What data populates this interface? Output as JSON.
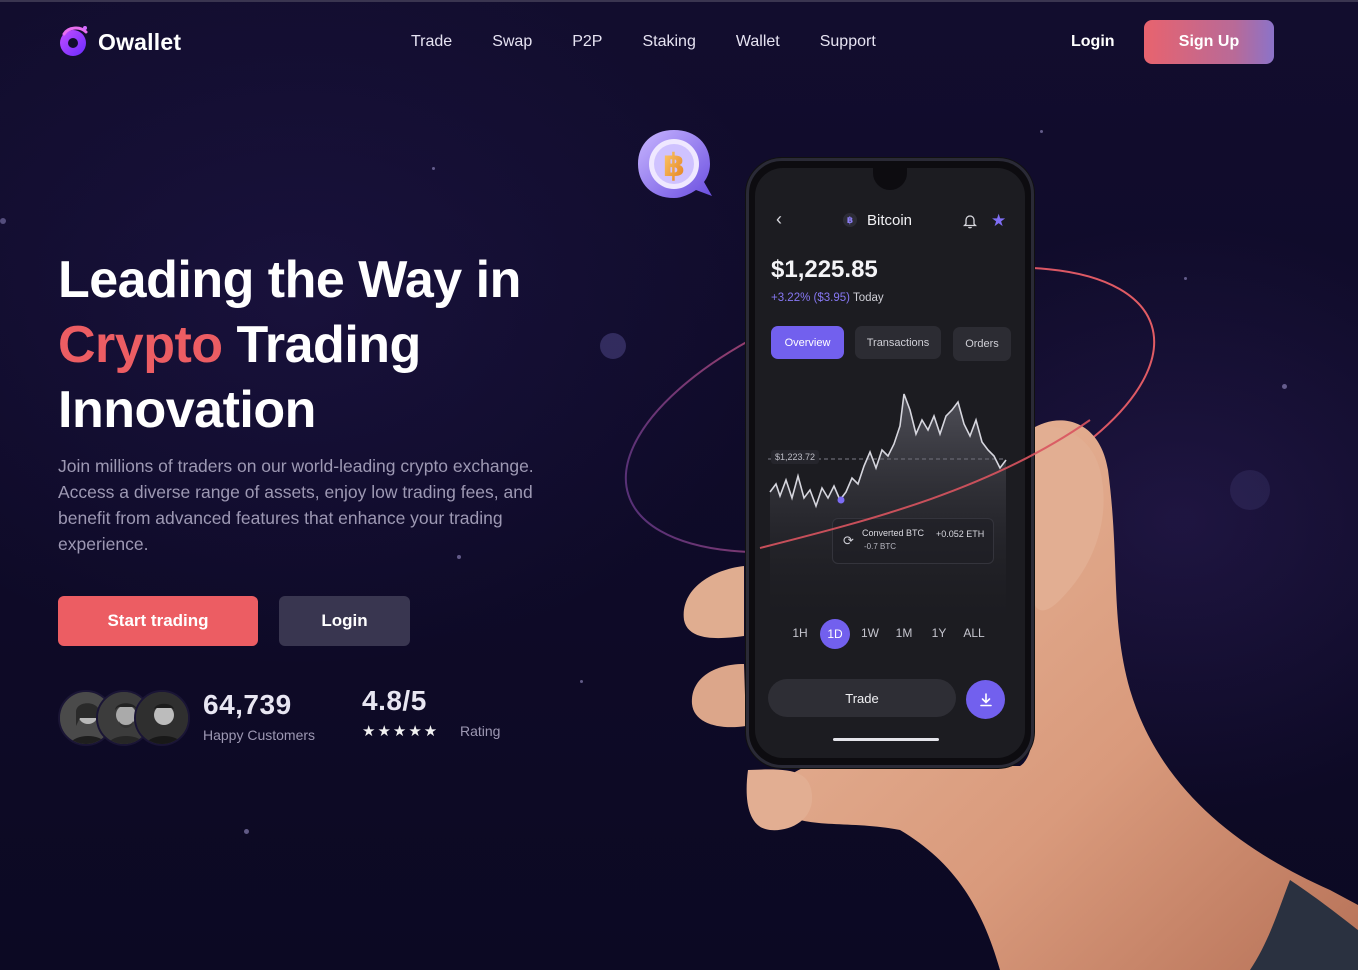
{
  "brand": {
    "name": "Owallet"
  },
  "nav": {
    "items": [
      "Trade",
      "Swap",
      "P2P",
      "Staking",
      "Wallet",
      "Support"
    ]
  },
  "header": {
    "login_label": "Login",
    "signup_label": "Sign Up"
  },
  "hero": {
    "title_line1": "Leading the Way in",
    "title_accent": "Crypto",
    "title_line2_rest": " Trading",
    "title_line3": "Innovation",
    "description": "Join millions of traders on our world-leading crypto exchange. Access a diverse range of assets, enjoy low trading fees, and benefit from advanced features that enhance your trading experience.",
    "cta_primary": "Start trading",
    "cta_secondary": "Login"
  },
  "stats": {
    "customers_value": "64,739",
    "customers_label": "Happy Customers",
    "rating_value": "4.8/5",
    "rating_stars": "★★★★★",
    "rating_label": "Rating"
  },
  "phone": {
    "coin_name": "Bitcoin",
    "coin_symbol": "฿",
    "price": "$1,225.85",
    "change": "+3.22% ($3.95)",
    "change_period": "Today",
    "tabs": [
      "Overview",
      "Transactions",
      "Orders"
    ],
    "active_tab": "Overview",
    "reference_price": "$1,223.72",
    "converted_label": "Converted BTC",
    "converted_sub": "-0.7 BTC",
    "converted_amount": "+0.052 ETH",
    "ranges": [
      "1H",
      "1D",
      "1W",
      "1M",
      "1Y",
      "ALL"
    ],
    "active_range": "1D",
    "trade_label": "Trade"
  },
  "colors": {
    "accent_red": "#ec5d63",
    "accent_purple": "#7260ee",
    "background": "#120d2e"
  }
}
